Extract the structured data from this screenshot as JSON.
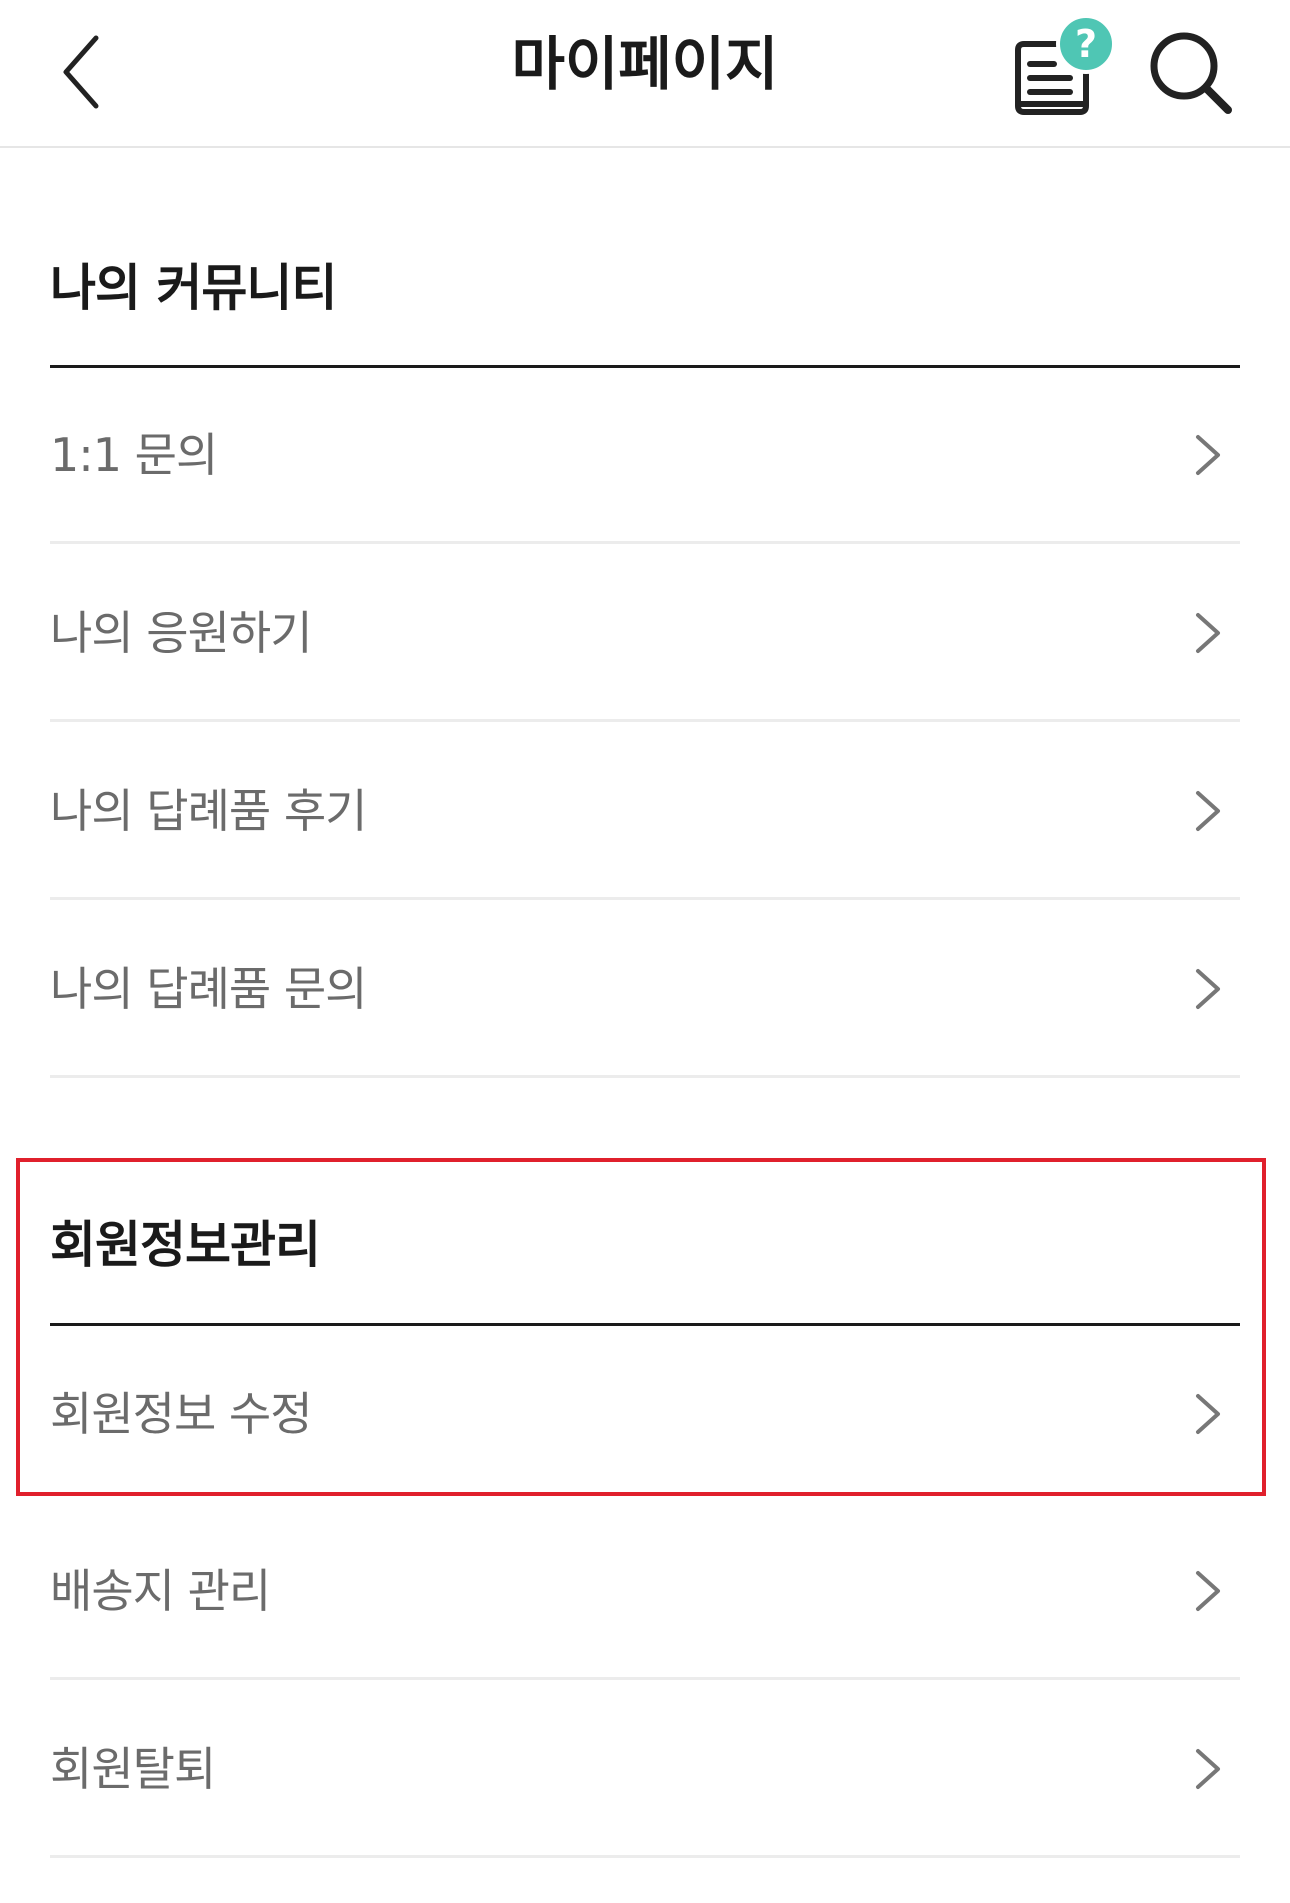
{
  "header": {
    "title": "마이페이지",
    "back_icon": "chevron-left-icon",
    "qna_icon": "document-question-icon",
    "qna_badge": "?",
    "search_icon": "search-icon",
    "badge_color": "#4fc6b4"
  },
  "community": {
    "title": "나의 커뮤니티",
    "items": [
      {
        "label": "1:1 문의"
      },
      {
        "label": "나의 응원하기"
      },
      {
        "label": "나의 답례품 후기"
      },
      {
        "label": "나의 답례품 문의"
      }
    ]
  },
  "member": {
    "title": "회원정보관리",
    "items": [
      {
        "label": "회원정보 수정"
      },
      {
        "label": "배송지 관리"
      },
      {
        "label": "회원탈퇴"
      }
    ]
  },
  "highlight_color": "#e0202c"
}
